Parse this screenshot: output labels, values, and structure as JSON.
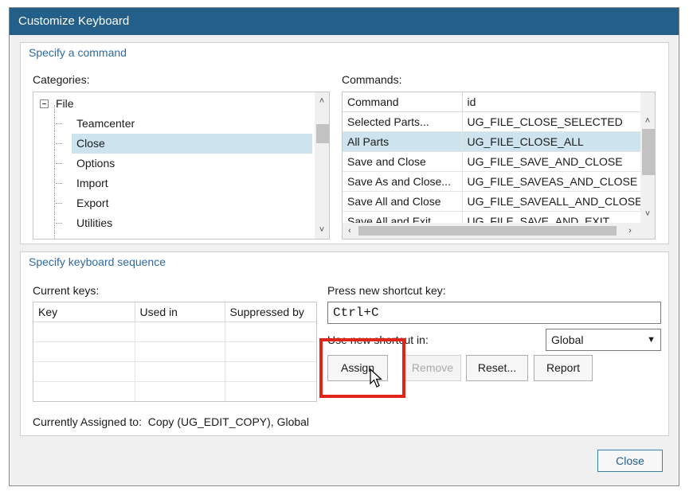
{
  "window": {
    "title": "Customize Keyboard"
  },
  "specify_command": {
    "group_title": "Specify a command",
    "categories_label": "Categories:",
    "tree": {
      "root": "File",
      "children": [
        "Teamcenter",
        "Close",
        "Options",
        "Import",
        "Export",
        "Utilities"
      ],
      "selected": "Close"
    },
    "commands_label": "Commands:",
    "commands_table": {
      "headers": [
        "Command",
        "id"
      ],
      "rows": [
        [
          "Selected Parts...",
          "UG_FILE_CLOSE_SELECTED"
        ],
        [
          "All Parts",
          "UG_FILE_CLOSE_ALL"
        ],
        [
          "Save and Close",
          "UG_FILE_SAVE_AND_CLOSE"
        ],
        [
          "Save As and Close...",
          "UG_FILE_SAVEAS_AND_CLOSE"
        ],
        [
          "Save All and Close",
          "UG_FILE_SAVEALL_AND_CLOSE"
        ],
        [
          "Save All and Exit",
          "UG_FILE_SAVE_AND_EXIT"
        ]
      ],
      "selected_row": 1
    }
  },
  "keyboard_sequence": {
    "group_title": "Specify keyboard sequence",
    "current_keys_label": "Current keys:",
    "keys_headers": [
      "Key",
      "Used in",
      "Suppressed by"
    ],
    "press_label": "Press new shortcut key:",
    "shortcut_value": "Ctrl+C",
    "use_in_label": "Use new shortcut in:",
    "use_in_value": "Global",
    "buttons": {
      "assign": "Assign",
      "remove": "Remove",
      "reset": "Reset...",
      "report": "Report"
    },
    "assigned_label": "Currently Assigned to:",
    "assigned_value": "Copy (UG_EDIT_COPY), Global"
  },
  "footer": {
    "close": "Close"
  },
  "colors": {
    "titlebar": "#245f89",
    "selection": "#cde3ee",
    "group_title": "#2d6aa2",
    "highlight": "#e1251b"
  }
}
